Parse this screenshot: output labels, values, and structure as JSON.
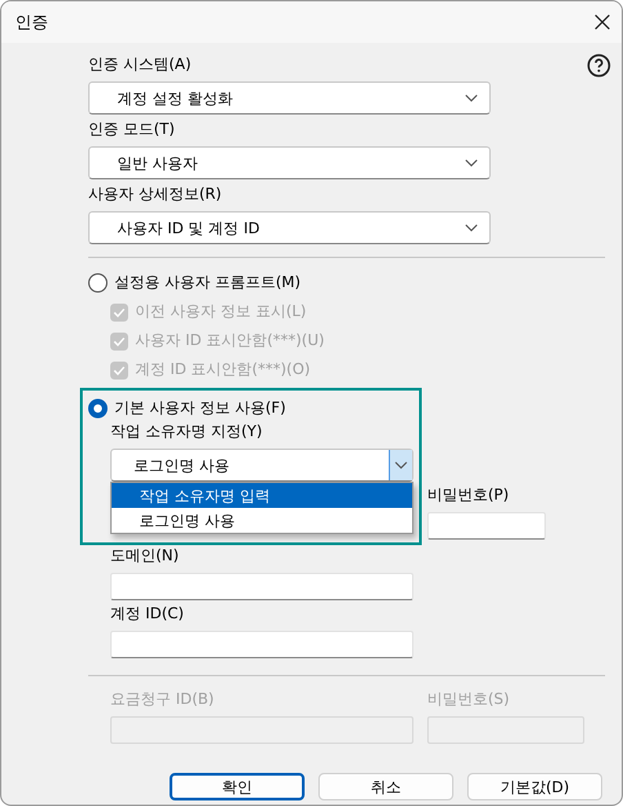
{
  "window": {
    "title": "인증"
  },
  "selects": [
    {
      "label": "인증 시스템(A)",
      "value": "계정 설정 활성화"
    },
    {
      "label": "인증 모드(T)",
      "value": "일반 사용자"
    },
    {
      "label": "사용자 상세정보(R)",
      "value": "사용자 ID 및 계정 ID"
    }
  ],
  "prompt_option": {
    "label": "설정용 사용자 프롬프트(M)",
    "selected": false,
    "checkboxes": [
      {
        "label": "이전 사용자 정보 표시(L)",
        "checked": true,
        "disabled": true
      },
      {
        "label": "사용자 ID 표시안함(***)(U)",
        "checked": true,
        "disabled": true
      },
      {
        "label": "계정 ID 표시안함(***)(O)",
        "checked": true,
        "disabled": true
      }
    ]
  },
  "default_option": {
    "label": "기본 사용자 정보 사용(F)",
    "selected": true,
    "focused": true,
    "owner_label": "작업 소유자명 지정(Y)",
    "owner_value": "로그인명 사용",
    "expanded": true,
    "options": [
      {
        "label": "작업 소유자명 입력",
        "selected": true
      },
      {
        "label": "로그인명 사용",
        "selected": false
      }
    ]
  },
  "password": {
    "label": "비밀번호(P)"
  },
  "domain": {
    "label": "도메인(N)"
  },
  "account_id": {
    "label": "계정 ID(C)"
  },
  "billing": {
    "disabled": true,
    "id_label": "요금청구 ID(B)",
    "password_label": "비밀번호(S)"
  },
  "buttons": [
    {
      "label": "확인",
      "default": true
    },
    {
      "label": "취소",
      "default": false
    },
    {
      "label": "기본값(D)",
      "default": false
    }
  ]
}
